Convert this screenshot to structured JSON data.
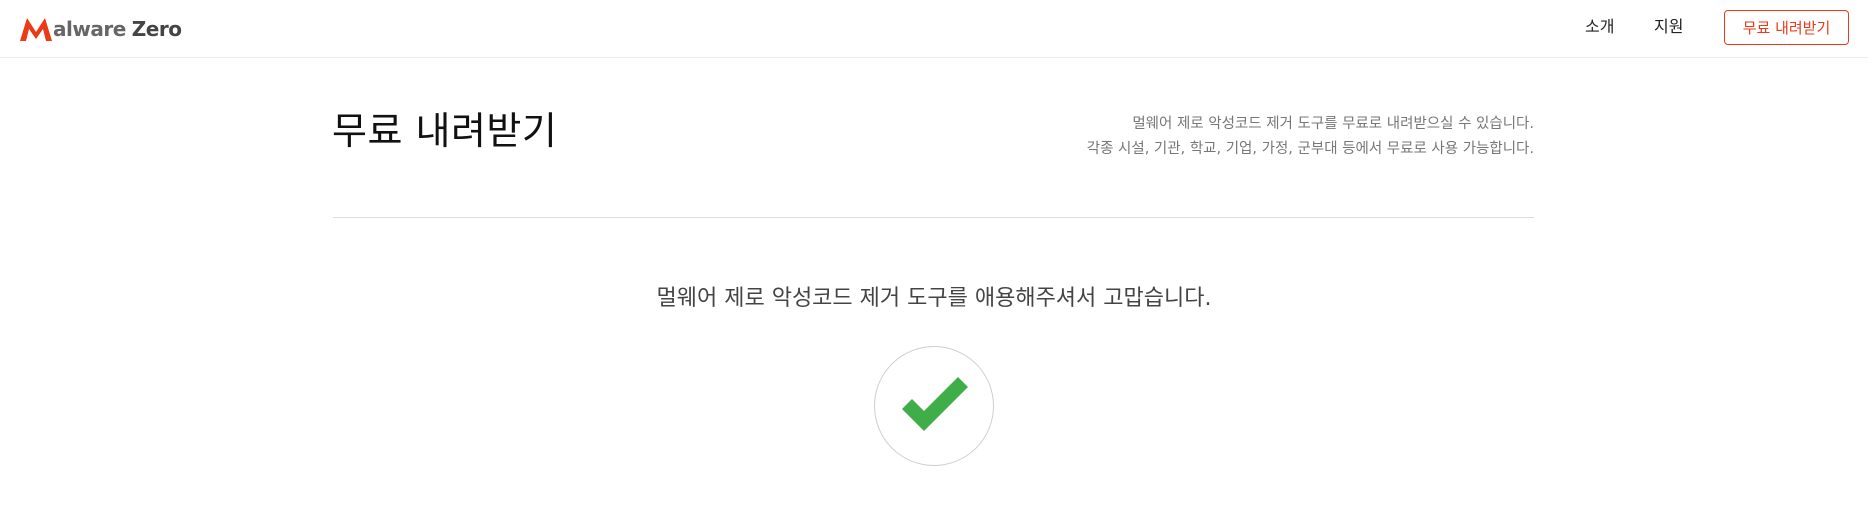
{
  "header": {
    "logo": {
      "brand_part1": "alware",
      "brand_part2": "Zero",
      "brand_full": "Malware Zero",
      "mark_icon": "malware-zero-m-logo",
      "mark_color": "#ea3a17"
    },
    "nav": [
      {
        "label": "소개"
      },
      {
        "label": "지원"
      }
    ],
    "download_button": {
      "label": "무료 내려받기",
      "color": "#ea3a17"
    }
  },
  "main": {
    "title": "무료 내려받기",
    "description_lines": [
      "멀웨어 제로 악성코드 제거 도구를 무료로 내려받으실 수 있습니다.",
      "각종 시설, 기관, 학교, 기업, 가정, 군부대 등에서 무료로 사용 가능합니다."
    ],
    "thanks_message": "멀웨어 제로 악성코드 제거 도구를 애용해주셔서 고맙습니다.",
    "success_icon": "check-icon",
    "success_color": "#3fae49"
  }
}
